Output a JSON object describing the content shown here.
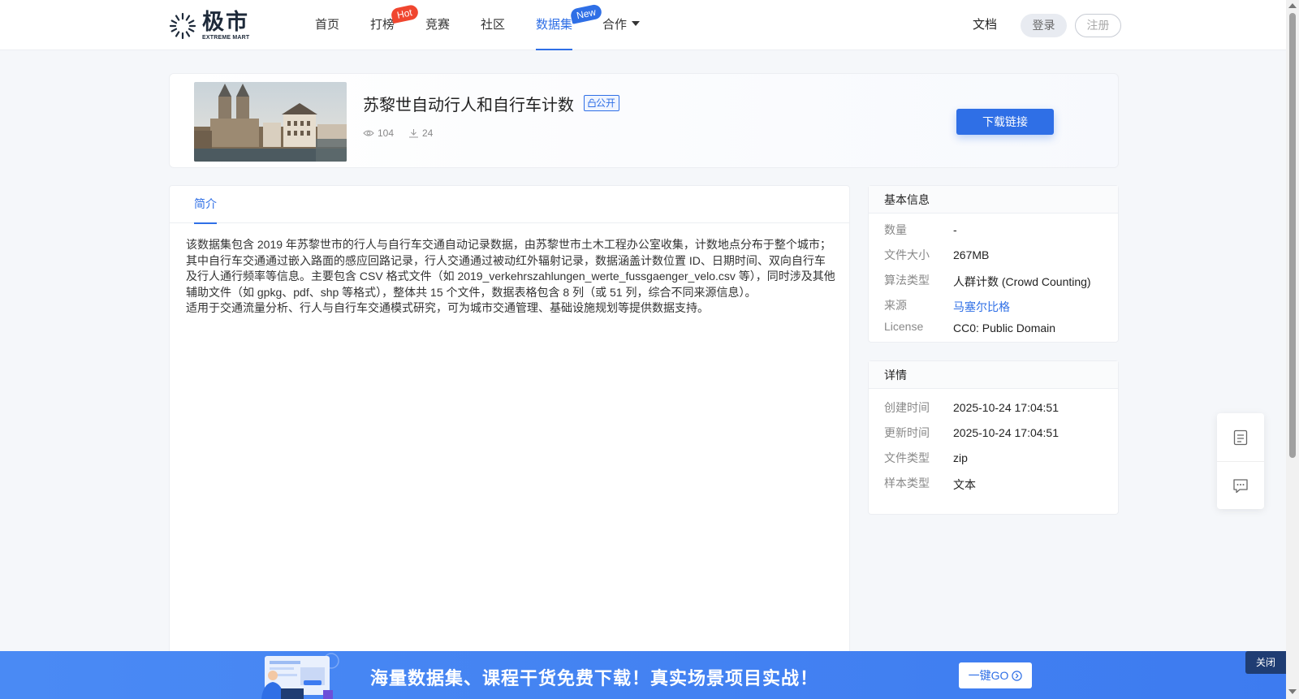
{
  "header": {
    "logo_cn": "极市",
    "logo_en": "EXTREME MART",
    "nav": [
      {
        "label": "首页"
      },
      {
        "label": "打榜",
        "badge": "Hot"
      },
      {
        "label": "竞赛"
      },
      {
        "label": "社区"
      },
      {
        "label": "数据集",
        "badge": "New",
        "active": true
      },
      {
        "label": "合作",
        "dropdown": true
      }
    ],
    "docs_label": "文档",
    "login_label": "登录",
    "register_label": "注册"
  },
  "dataset": {
    "title": "苏黎世自动行人和自行车计数",
    "visibility": "公开",
    "views": "104",
    "downloads": "24",
    "download_button": "下载链接"
  },
  "intro": {
    "tab_label": "简介",
    "paragraph1": "该数据集包含 2019 年苏黎世市的行人与自行车交通自动记录数据，由苏黎世市土木工程办公室收集，计数地点分布于整个城市；其中自行车交通通过嵌入路面的感应回路记录，行人交通通过被动红外辐射记录，数据涵盖计数位置 ID、日期时间、双向自行车及行人通行频率等信息。主要包含 CSV 格式文件（如 2019_verkehrszahlungen_werte_fussgaenger_velo.csv 等），同时涉及其他辅助文件（如 gpkg、pdf、shp 等格式），整体共 15 个文件，数据表格包含 8 列（或 51 列，综合不同来源信息）。",
    "paragraph2": "适用于交通流量分析、行人与自行车交通模式研究，可为城市交通管理、基础设施规划等提供数据支持。"
  },
  "basic_info": {
    "title": "基本信息",
    "rows": [
      {
        "key": "数量",
        "value": "-"
      },
      {
        "key": "文件大小",
        "value": "267MB"
      },
      {
        "key": "算法类型",
        "value": "人群计数 (Crowd Counting)"
      },
      {
        "key": "来源",
        "value": "马塞尔比格"
      },
      {
        "key": "License",
        "value": "CC0: Public Domain"
      }
    ]
  },
  "details": {
    "title": "详情",
    "rows": [
      {
        "key": "创建时间",
        "value": "2025-10-24 17:04:51"
      },
      {
        "key": "更新时间",
        "value": "2025-10-24 17:04:51"
      },
      {
        "key": "文件类型",
        "value": "zip"
      },
      {
        "key": "样本类型",
        "value": "文本"
      }
    ]
  },
  "banner": {
    "text": "海量数据集、课程干货免费下载！真实场景项目实战！",
    "go_label": "一键GO",
    "close_label": "关闭"
  },
  "colors": {
    "accent": "#2f6fe6",
    "hot_badge": "#f0462f",
    "banner": "#4a8af4"
  },
  "icons": [
    "eye-icon",
    "download-icon",
    "lock-icon",
    "document-icon",
    "chat-icon",
    "arrow-circle-icon",
    "chevron-down-icon"
  ]
}
